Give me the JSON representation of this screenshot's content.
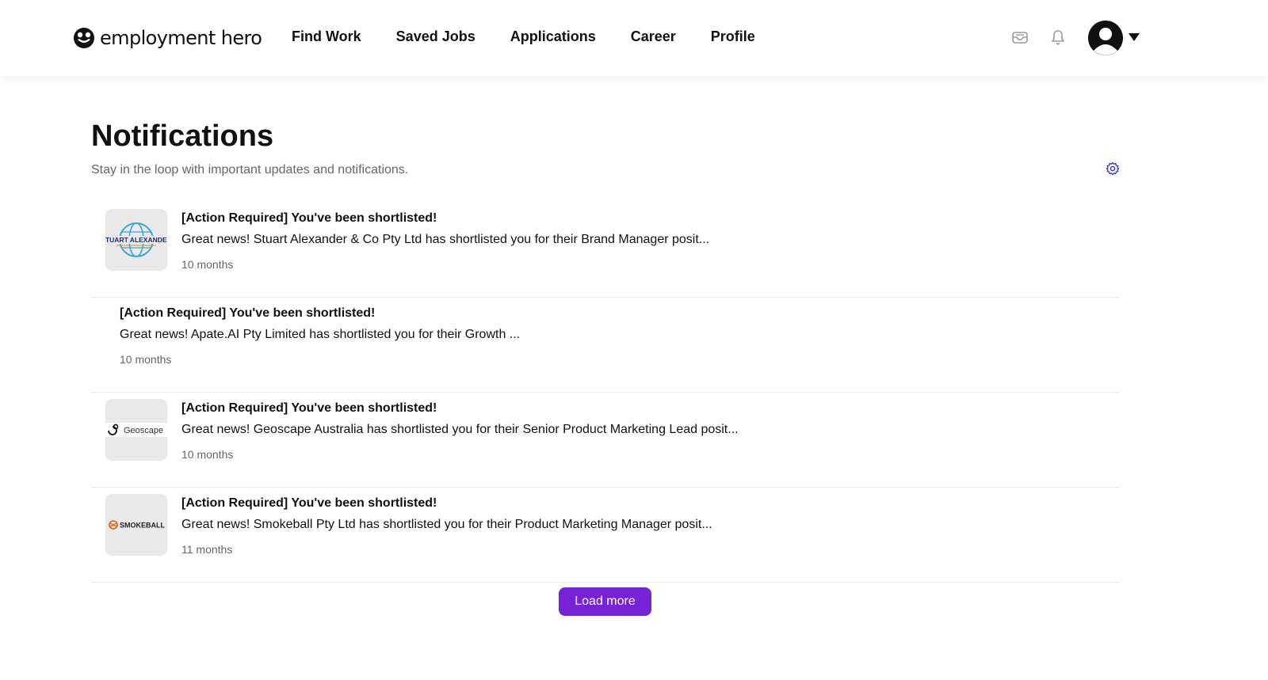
{
  "header": {
    "logo_text": "employment hero",
    "nav": [
      {
        "label": "Find Work"
      },
      {
        "label": "Saved Jobs"
      },
      {
        "label": "Applications"
      },
      {
        "label": "Career"
      },
      {
        "label": "Profile"
      }
    ],
    "icons": [
      "inbox-icon",
      "bell-icon",
      "avatar",
      "caret-down-icon"
    ]
  },
  "page": {
    "title": "Notifications",
    "subtitle": "Stay in the loop with important updates and notifications.",
    "settings_icon": "gear-icon"
  },
  "notifications": [
    {
      "logo_text": "STUART ALEXANDER",
      "title": "[Action Required] You've been shortlisted!",
      "body": "Great news! Stuart Alexander & Co Pty Ltd has shortlisted you for their Brand Manager posit...",
      "time": "10 months"
    },
    {
      "logo_text": "",
      "title": "[Action Required] You've been shortlisted!",
      "body": "Great news! Apate.AI Pty Limited has shortlisted you for their Growth ...",
      "time": "10 months"
    },
    {
      "logo_text": "Geoscape",
      "title": "[Action Required] You've been shortlisted!",
      "body": "Great news! Geoscape Australia has shortlisted you for their Senior Product Marketing Lead posit...",
      "time": "10 months"
    },
    {
      "logo_text": "SMOKEBALL",
      "title": "[Action Required] You've been shortlisted!",
      "body": "Great news! Smokeball Pty Ltd has shortlisted you for their Product Marketing Manager posit...",
      "time": "11 months"
    }
  ],
  "load_more_label": "Load more",
  "colors": {
    "accent": "#7622d7",
    "settings_icon": "#3b3bd1",
    "muted_text": "#666666",
    "divider": "#e6e6e6"
  }
}
